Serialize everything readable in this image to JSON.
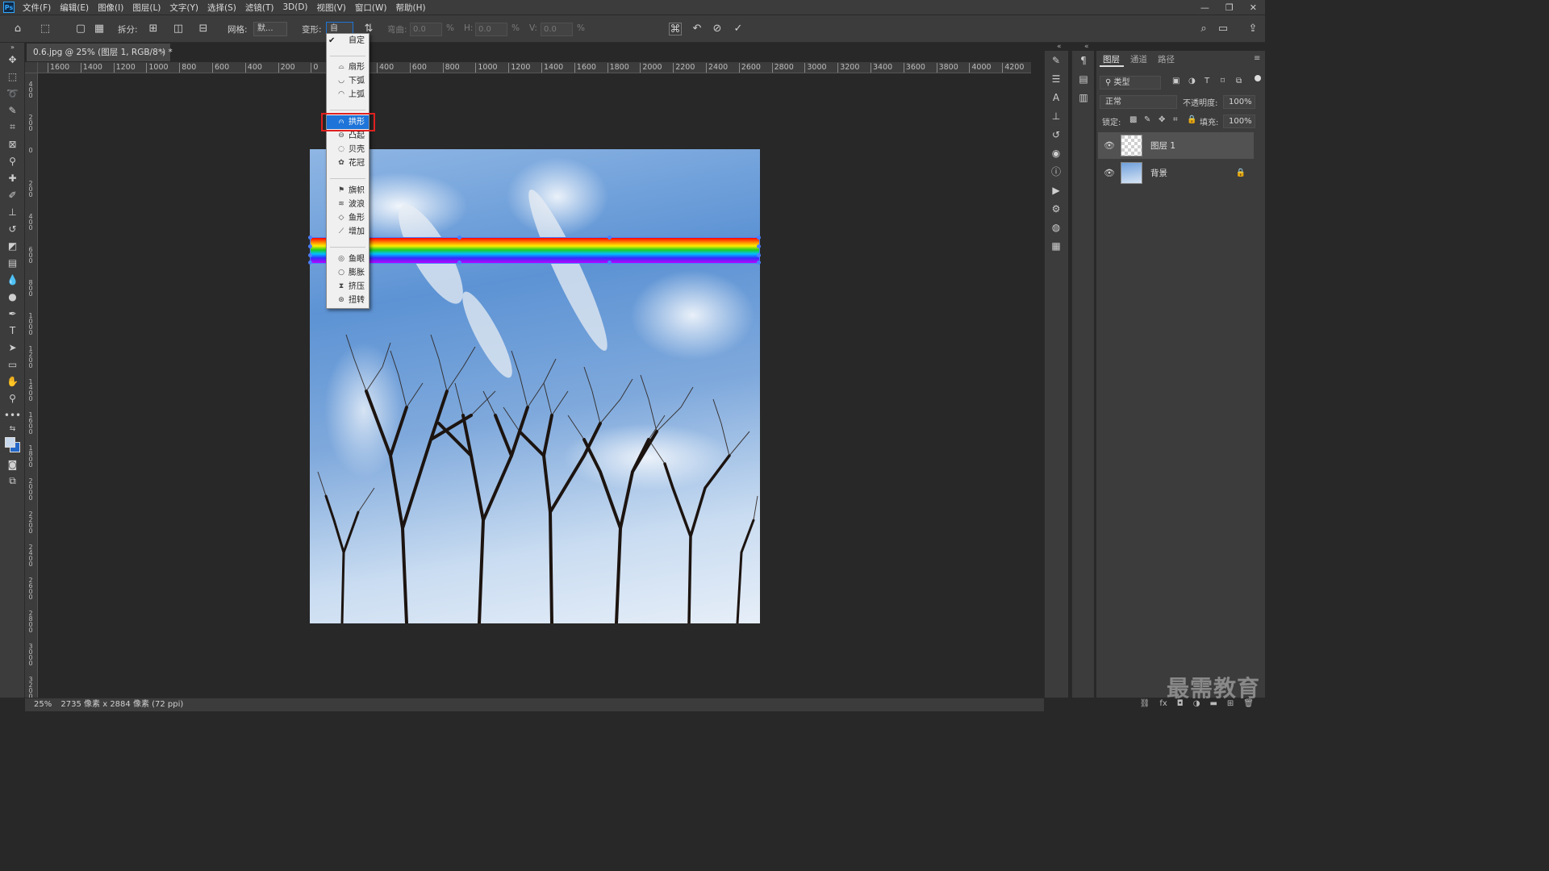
{
  "app": {
    "logo": "Ps"
  },
  "menu": [
    "文件(F)",
    "编辑(E)",
    "图像(I)",
    "图层(L)",
    "文字(Y)",
    "选择(S)",
    "滤镜(T)",
    "3D(D)",
    "视图(V)",
    "窗口(W)",
    "帮助(H)"
  ],
  "window_controls": [
    "—",
    "❐",
    "✕"
  ],
  "options": {
    "split_label": "拆分:",
    "grid_label": "网格:",
    "grid_value": "默...",
    "warp_label": "变形:",
    "warp_value": "自",
    "bend_label": "弯曲:",
    "bend_value": "0.0",
    "h_label": "H:",
    "h_value": "0.0",
    "v_label": "V:",
    "v_value": "0.0",
    "percent": "%"
  },
  "document": {
    "tab_title": "0.6.jpg @ 25% (图层 1, RGB/8*) *",
    "tab_close": "×",
    "ruler_top": [
      "1600",
      "1400",
      "1200",
      "1000",
      "800",
      "600",
      "400",
      "200",
      "0",
      "",
      "400",
      "600",
      "800",
      "1000",
      "1200",
      "1400",
      "1600",
      "1800",
      "2000",
      "2200",
      "2400",
      "2600",
      "2800",
      "3000",
      "3200",
      "3400",
      "3600",
      "3800",
      "4000",
      "4200"
    ],
    "ruler_left": [
      "4 0 0",
      "2 0 0",
      "0",
      "2 0 0",
      "4 0 0",
      "6 0 0",
      "8 0 0",
      "1 0 0 0",
      "1 2 0 0",
      "1 4 0 0",
      "1 6 0 0",
      "1 8 0 0",
      "2 0 0 0",
      "2 2 0 0",
      "2 4 0 0",
      "2 6 0 0",
      "2 8 0 0",
      "3 0 0 0",
      "3 2 0 0"
    ]
  },
  "warp_menu": {
    "items": [
      {
        "label": "自定",
        "icon": "check-icon",
        "checked": true
      },
      {
        "label": "扇形",
        "icon": "arc-icon"
      },
      {
        "label": "下弧",
        "icon": "arc-lower-icon"
      },
      {
        "label": "上弧",
        "icon": "arc-upper-icon"
      },
      {
        "label": "拱形",
        "icon": "arch-icon",
        "selected": true
      },
      {
        "label": "凸起",
        "icon": "bulge-icon"
      },
      {
        "label": "贝壳",
        "icon": "shell-icon"
      },
      {
        "label": "花冠",
        "icon": "flower-icon"
      },
      {
        "label": "旗帜",
        "icon": "flag-icon"
      },
      {
        "label": "波浪",
        "icon": "wave-icon"
      },
      {
        "label": "鱼形",
        "icon": "fish-icon"
      },
      {
        "label": "增加",
        "icon": "rise-icon"
      },
      {
        "label": "鱼眼",
        "icon": "fisheye-icon"
      },
      {
        "label": "膨胀",
        "icon": "inflate-icon"
      },
      {
        "label": "挤压",
        "icon": "squeeze-icon"
      },
      {
        "label": "扭转",
        "icon": "twist-icon"
      }
    ]
  },
  "layers_panel": {
    "tabs": [
      "图层",
      "通道",
      "路径"
    ],
    "filter_value": "类型",
    "blend_mode": "正常",
    "opacity_label": "不透明度:",
    "opacity_value": "100%",
    "lock_label": "锁定:",
    "fill_label": "填充:",
    "fill_value": "100%",
    "layers": [
      {
        "name": "图层 1",
        "thumb": "transparent",
        "active": true
      },
      {
        "name": "背景",
        "thumb": "sky",
        "locked": true
      }
    ]
  },
  "status": {
    "zoom": "25%",
    "info": "2735 像素 x 2884 像素 (72 ppi)"
  },
  "watermark": "最需教育",
  "colors": {
    "accent": "#1e74d8",
    "highlight_box": "#e02020",
    "transform_handles": "#4a7fff",
    "panel_bg": "#3c3c3c",
    "canvas_bg": "#282828"
  }
}
